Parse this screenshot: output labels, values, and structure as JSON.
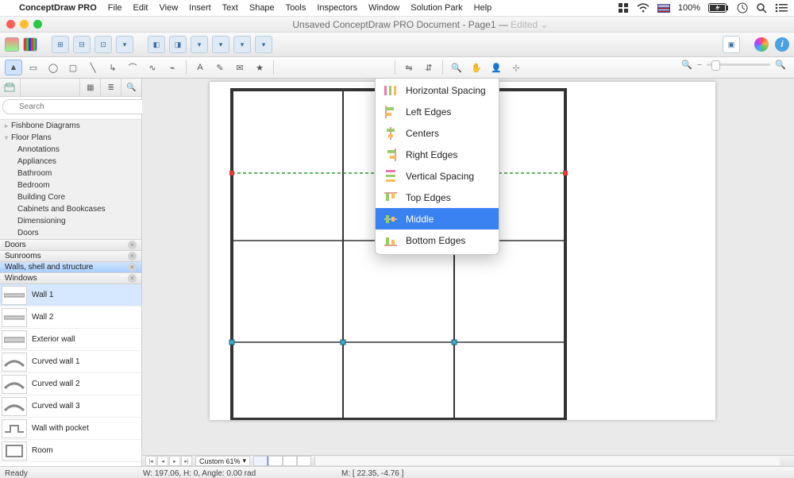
{
  "menubar": {
    "app": "ConceptDraw PRO",
    "items": [
      "File",
      "Edit",
      "View",
      "Insert",
      "Text",
      "Shape",
      "Tools",
      "Inspectors",
      "Window",
      "Solution Park",
      "Help"
    ],
    "battery": "100%",
    "battery_icon_label": "battery-charging"
  },
  "window": {
    "title_prefix": "Unsaved ConceptDraw PRO Document - Page1 —",
    "edited": "Edited"
  },
  "search": {
    "placeholder": "Search"
  },
  "tree": {
    "fishbone": "Fishbone Diagrams",
    "floor": "Floor Plans",
    "subs": [
      "Annotations",
      "Appliances",
      "Bathroom",
      "Bedroom",
      "Building Core",
      "Cabinets and Bookcases",
      "Dimensioning",
      "Doors"
    ]
  },
  "accordion": {
    "doors": "Doors",
    "sunrooms": "Sunrooms",
    "walls": "Walls, shell and structure",
    "windows": "Windows"
  },
  "palette": {
    "items": [
      "Wall 1",
      "Wall 2",
      "Exterior wall",
      "Curved wall 1",
      "Curved wall 2",
      "Curved wall 3",
      "Wall with pocket",
      "Room"
    ]
  },
  "dropdown": {
    "items": [
      "Horizontal Spacing",
      "Left Edges",
      "Centers",
      "Right Edges",
      "Vertical Spacing",
      "Top Edges",
      "Middle",
      "Bottom Edges"
    ],
    "selected_index": 6
  },
  "footer": {
    "custom": "Custom 61%",
    "ready": "Ready",
    "whangle": "W: 197.06,  H: 0,  Angle: 0.00 rad",
    "coords": "M: [ 22.35, -4.76 ]"
  }
}
